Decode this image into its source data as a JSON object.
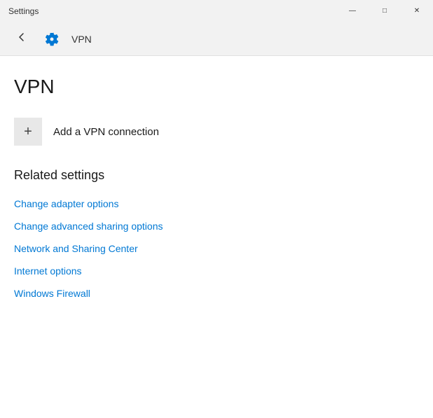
{
  "window": {
    "title": "Settings",
    "controls": {
      "minimize": "—",
      "maximize": "□",
      "close": "✕"
    }
  },
  "header": {
    "title": "VPN",
    "icon": "gear-icon"
  },
  "page": {
    "title": "VPN",
    "add_vpn_label": "Add a VPN connection"
  },
  "related_settings": {
    "heading": "Related settings",
    "links": [
      {
        "label": "Change adapter options",
        "id": "change-adapter-options"
      },
      {
        "label": "Change advanced sharing options",
        "id": "change-advanced-sharing"
      },
      {
        "label": "Network and Sharing Center",
        "id": "network-sharing-center"
      },
      {
        "label": "Internet options",
        "id": "internet-options"
      },
      {
        "label": "Windows Firewall",
        "id": "windows-firewall"
      }
    ]
  },
  "colors": {
    "accent": "#0078d4",
    "link": "#0078d4"
  }
}
